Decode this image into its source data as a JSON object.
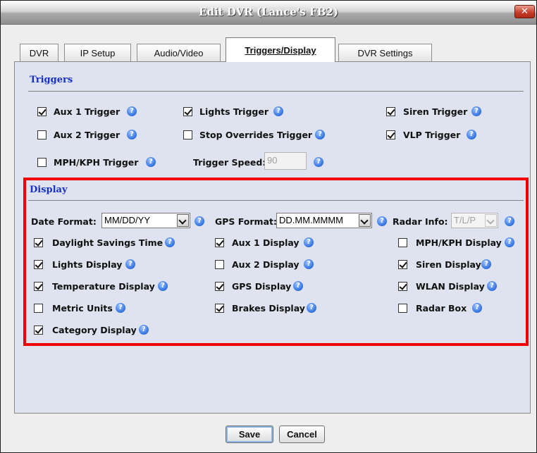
{
  "window": {
    "title": "Edit DVR (Lance's FB2)",
    "close_glyph": "✕"
  },
  "tabs": [
    "DVR",
    "IP Setup",
    "Audio/Video",
    "Triggers/Display",
    "DVR Settings"
  ],
  "active_tab": "Triggers/Display",
  "triggers": {
    "title": "Triggers",
    "items": [
      {
        "label": "Aux 1 Trigger",
        "checked": true
      },
      {
        "label": "Lights Trigger",
        "checked": true
      },
      {
        "label": "Siren Trigger",
        "checked": true
      },
      {
        "label": "Aux 2 Trigger",
        "checked": false
      },
      {
        "label": "Stop Overrides Trigger",
        "checked": false
      },
      {
        "label": "VLP Trigger",
        "checked": true
      },
      {
        "label": "MPH/KPH Trigger",
        "checked": false
      }
    ],
    "trigger_speed_label": "Trigger Speed:",
    "trigger_speed_value": "90"
  },
  "display": {
    "title": "Display",
    "date_format_label": "Date Format:",
    "date_format_value": "MM/DD/YY",
    "gps_format_label": "GPS Format:",
    "gps_format_value": "DD.MM.MMMM",
    "radar_info_label": "Radar Info:",
    "radar_info_value": "T/L/P",
    "items": [
      {
        "label": "Daylight Savings Time",
        "checked": true
      },
      {
        "label": "Aux 1 Display",
        "checked": true
      },
      {
        "label": "MPH/KPH Display",
        "checked": false
      },
      {
        "label": "Lights Display",
        "checked": true
      },
      {
        "label": "Aux 2 Display",
        "checked": false
      },
      {
        "label": "Siren Display",
        "checked": true
      },
      {
        "label": "Temperature Display",
        "checked": true
      },
      {
        "label": "GPS Display",
        "checked": true
      },
      {
        "label": "WLAN Display",
        "checked": true
      },
      {
        "label": "Metric Units",
        "checked": false
      },
      {
        "label": "Brakes Display",
        "checked": true
      },
      {
        "label": "Radar Box",
        "checked": false
      },
      {
        "label": "Category Display",
        "checked": true
      }
    ]
  },
  "buttons": {
    "save": "Save",
    "cancel": "Cancel"
  },
  "help_glyph": "?",
  "colors": {
    "highlight": "#f00000",
    "section_title": "#1730c8",
    "help_icon": "#2e6fe0"
  }
}
